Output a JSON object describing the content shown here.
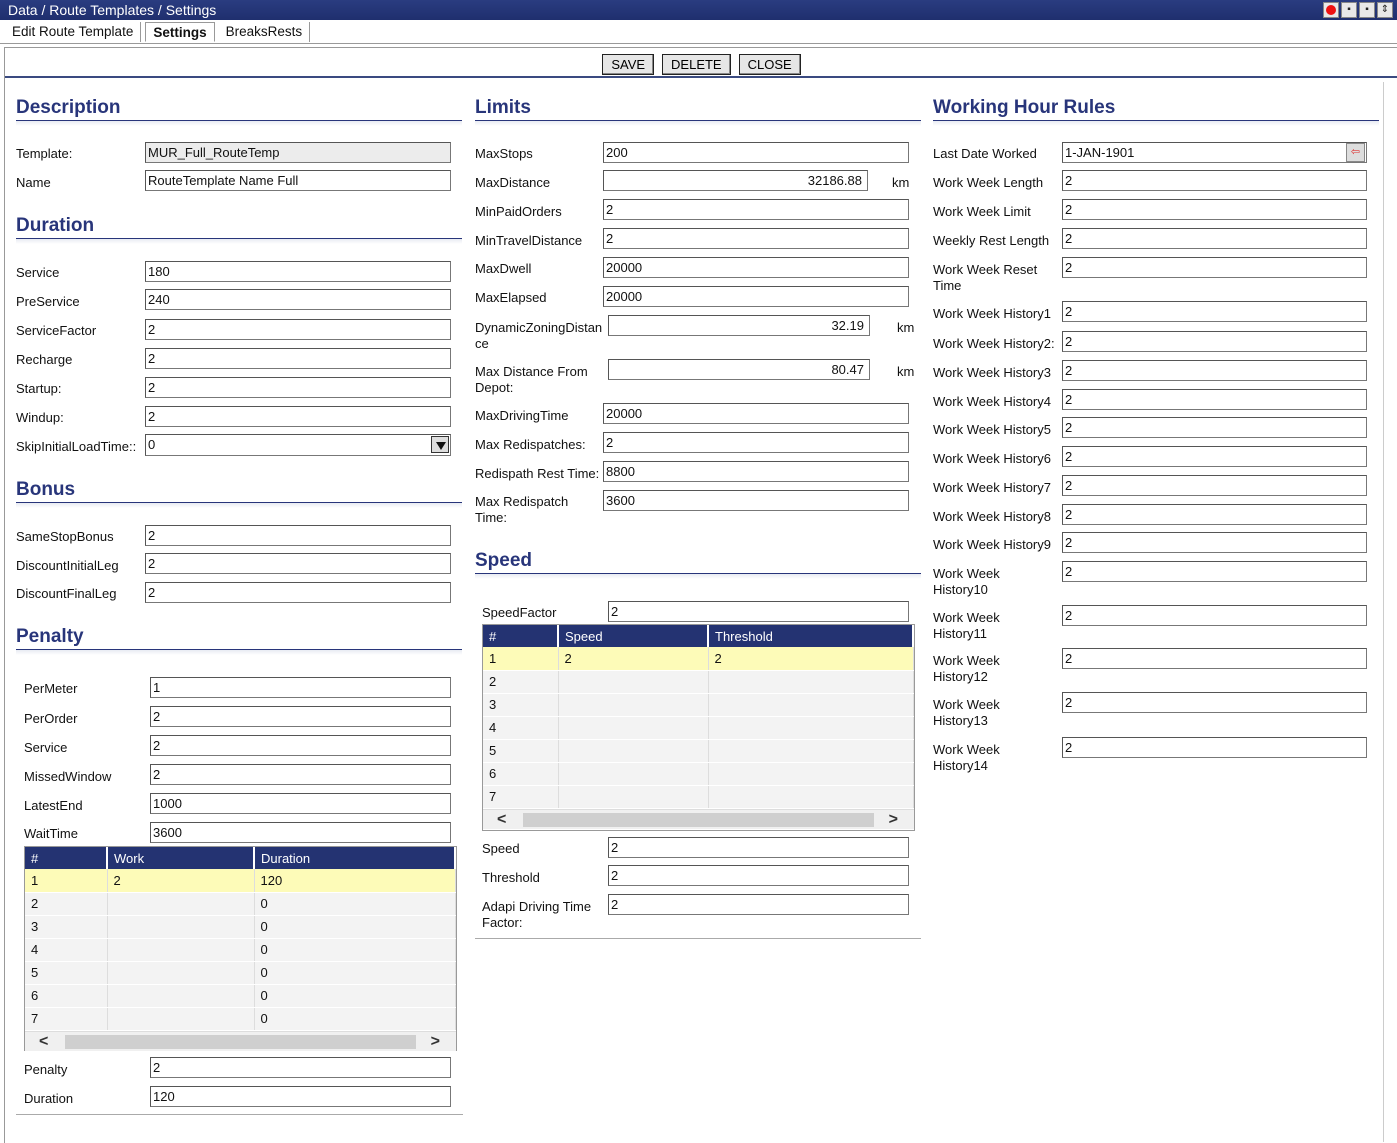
{
  "window": {
    "title": "Data / Route Templates / Settings"
  },
  "tabs": [
    {
      "label": "Edit Route Template"
    },
    {
      "label": "Settings"
    },
    {
      "label": "BreaksRests"
    }
  ],
  "toolbar": {
    "save": "SAVE",
    "delete": "DELETE",
    "close": "CLOSE"
  },
  "description": {
    "title": "Description",
    "template_label": "Template:",
    "template_value": "MUR_Full_RouteTemp",
    "name_label": "Name",
    "name_value": "RouteTemplate Name Full"
  },
  "duration": {
    "title": "Duration",
    "fields": [
      {
        "label": "Service",
        "value": "180"
      },
      {
        "label": "PreService",
        "value": "240"
      },
      {
        "label": "ServiceFactor",
        "value": "2"
      },
      {
        "label": "Recharge",
        "value": "2"
      },
      {
        "label": "Startup:",
        "value": "2"
      },
      {
        "label": "Windup:",
        "value": "2"
      }
    ],
    "skip_label": "SkipInitialLoadTime::",
    "skip_value": "0"
  },
  "bonus": {
    "title": "Bonus",
    "fields": [
      {
        "label": "SameStopBonus",
        "value": "2"
      },
      {
        "label": "DiscountInitialLeg",
        "value": "2"
      },
      {
        "label": "DiscountFinalLeg",
        "value": "2"
      }
    ]
  },
  "penalty": {
    "title": "Penalty",
    "fields": [
      {
        "label": "PerMeter",
        "value": "1"
      },
      {
        "label": "PerOrder",
        "value": "2"
      },
      {
        "label": "Service",
        "value": "2"
      },
      {
        "label": "MissedWindow",
        "value": "2"
      },
      {
        "label": "LatestEnd",
        "value": "1000"
      },
      {
        "label": "WaitTime",
        "value": "3600"
      }
    ],
    "grid": {
      "columns": [
        "#",
        "Work",
        "Duration"
      ],
      "rows": [
        [
          "1",
          "2",
          "120"
        ],
        [
          "2",
          "",
          "0"
        ],
        [
          "3",
          "",
          "0"
        ],
        [
          "4",
          "",
          "0"
        ],
        [
          "5",
          "",
          "0"
        ],
        [
          "6",
          "",
          "0"
        ],
        [
          "7",
          "",
          "0"
        ]
      ]
    },
    "penalty_label": "Penalty",
    "penalty_value": "2",
    "duration_label": "Duration",
    "duration_value": "120"
  },
  "limits": {
    "title": "Limits",
    "maxstops_label": "MaxStops",
    "maxstops_value": "200",
    "maxdistance_label": "MaxDistance",
    "maxdistance_value": "32186.88",
    "maxdistance_unit": "km",
    "minpaid_label": "MinPaidOrders",
    "minpaid_value": "2",
    "mintravel_label": "MinTravelDistance",
    "mintravel_value": "2",
    "maxdwell_label": "MaxDwell",
    "maxdwell_value": "20000",
    "maxelapsed_label": "MaxElapsed",
    "maxelapsed_value": "20000",
    "dynzone_label1": "DynamicZoningDistan",
    "dynzone_label2": "ce",
    "dynzone_value": "32.19",
    "dynzone_unit": "km",
    "maxdepot_label1": "Max Distance From",
    "maxdepot_label2": "Depot:",
    "maxdepot_value": "80.47",
    "maxdepot_unit": "km",
    "maxdriving_label": "MaxDrivingTime",
    "maxdriving_value": "20000",
    "maxredisp_label": "Max Redispatches:",
    "maxredisp_value": "2",
    "redisprest_label": "Redispath Rest Time:",
    "redisprest_value": "8800",
    "maxredisptime_label1": "Max Redispatch",
    "maxredisptime_label2": "Time:",
    "maxredisptime_value": "3600"
  },
  "speed": {
    "title": "Speed",
    "factor_label": "SpeedFactor",
    "factor_value": "2",
    "grid": {
      "columns": [
        "#",
        "Speed",
        "Threshold"
      ],
      "rows": [
        [
          "1",
          "2",
          "2"
        ],
        [
          "2",
          "",
          ""
        ],
        [
          "3",
          "",
          ""
        ],
        [
          "4",
          "",
          ""
        ],
        [
          "5",
          "",
          ""
        ],
        [
          "6",
          "",
          ""
        ],
        [
          "7",
          "",
          ""
        ]
      ]
    },
    "speed_label": "Speed",
    "speed_value": "2",
    "threshold_label": "Threshold",
    "threshold_value": "2",
    "adapi_label1": "Adapi Driving Time",
    "adapi_label2": "Factor:",
    "adapi_value": "2"
  },
  "working_hours": {
    "title": "Working Hour Rules",
    "last_date_label": "Last Date Worked",
    "last_date_value": "1-JAN-1901",
    "fields": [
      {
        "l1": "Work Week Length",
        "l2": "",
        "value": "2"
      },
      {
        "l1": "Work Week Limit",
        "l2": "",
        "value": "2"
      },
      {
        "l1": "Weekly Rest Length",
        "l2": "",
        "value": "2"
      },
      {
        "l1": "Work Week Reset",
        "l2": "Time",
        "value": "2"
      },
      {
        "l1": "Work Week History1",
        "l2": "",
        "value": "2"
      },
      {
        "l1": "Work Week History2:",
        "l2": "",
        "value": "2"
      },
      {
        "l1": "Work Week History3",
        "l2": "",
        "value": "2"
      },
      {
        "l1": "Work Week History4",
        "l2": "",
        "value": "2"
      },
      {
        "l1": "Work Week History5",
        "l2": "",
        "value": "2"
      },
      {
        "l1": "Work Week History6",
        "l2": "",
        "value": "2"
      },
      {
        "l1": "Work Week History7",
        "l2": "",
        "value": "2"
      },
      {
        "l1": "Work Week History8",
        "l2": "",
        "value": "2"
      },
      {
        "l1": "Work Week History9",
        "l2": "",
        "value": "2"
      },
      {
        "l1": "Work Week",
        "l2": "History10",
        "value": "2"
      },
      {
        "l1": "Work Week",
        "l2": "History11",
        "value": "2"
      },
      {
        "l1": "Work Week",
        "l2": "History12",
        "value": "2"
      },
      {
        "l1": "Work Week",
        "l2": "History13",
        "value": "2"
      },
      {
        "l1": "Work Week",
        "l2": "History14",
        "value": "2"
      }
    ]
  },
  "colors": {
    "title_bar": "#1f2f6e",
    "section_title": "#28357a",
    "grid_header": "#243372",
    "selected_row": "#fdfbb8"
  }
}
